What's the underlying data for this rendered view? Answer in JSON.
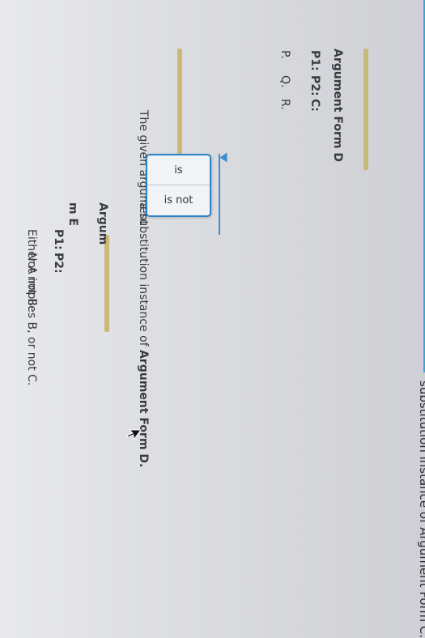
{
  "header": {
    "title_partial": "substitution instance of Argument Form C."
  },
  "form_d": {
    "title": "Argument Form D",
    "premises": [
      {
        "label": "P1:",
        "value": "P."
      },
      {
        "label": "P2:",
        "value": "Q."
      },
      {
        "label": "C:",
        "value": "R."
      }
    ]
  },
  "question": {
    "prefix": "The given argument",
    "suffix_plain": "a substitution instance of ",
    "suffix_bold": "Argument Form D."
  },
  "dropdown": {
    "options": [
      "is",
      "is not"
    ]
  },
  "form_e": {
    "title_left": "Argum",
    "title_right": "m E",
    "premises": [
      {
        "label": "P1:",
        "value": "Either A implies B, or not C."
      },
      {
        "label": "P2:",
        "value": "Not not B."
      }
    ]
  },
  "colors": {
    "accent_rule": "#c9b877",
    "select_blue": "#2b84c8"
  }
}
